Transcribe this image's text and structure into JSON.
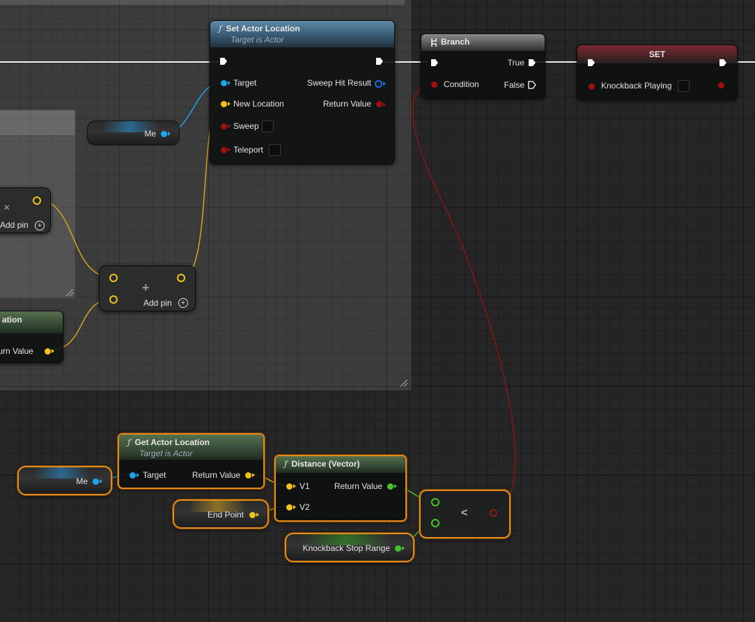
{
  "comment": {
    "label": ""
  },
  "set_actor_location": {
    "title": "Set Actor Location",
    "subtitle": "Target is Actor",
    "pins_in": [
      "Target",
      "New Location",
      "Sweep",
      "Teleport"
    ],
    "pins_out": [
      "Sweep Hit Result",
      "Return Value"
    ]
  },
  "branch": {
    "title": "Branch",
    "condition": "Condition",
    "true_label": "True",
    "false_label": "False"
  },
  "set_node": {
    "title": "SET",
    "var_label": "Knockback Playing"
  },
  "me_top": {
    "label": "Me"
  },
  "add_node_left": {
    "close_glyph": "×",
    "add_pin": "Add pin"
  },
  "add_node_mid": {
    "plus_glyph": "+",
    "add_pin": "Add pin"
  },
  "partial_node": {
    "title_fragment": "ation",
    "return_fragment": "turn Value"
  },
  "get_actor_location": {
    "title": "Get Actor Location",
    "subtitle": "Target is Actor",
    "target": "Target",
    "return": "Return Value"
  },
  "me_bottom": {
    "label": "Me"
  },
  "end_point": {
    "label": "End Point"
  },
  "distance": {
    "title": "Distance (Vector)",
    "v1": "V1",
    "v2": "V2",
    "return": "Return Value"
  },
  "less_than": {
    "symbol": "<"
  },
  "knockback_stop_range": {
    "label": "Knockback Stop Range"
  },
  "icons": {
    "function": "ƒ",
    "branch": "branch-icon"
  },
  "colors": {
    "object_pin": "#1aa7ec",
    "vector_pin": "#f2c21b",
    "float_pin": "#46c42c",
    "bool_pin": "#9d1010",
    "selection": "#e48a16"
  }
}
